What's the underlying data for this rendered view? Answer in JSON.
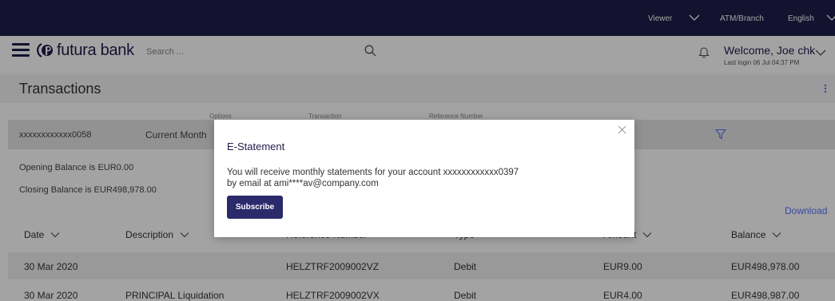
{
  "topbar": {
    "role": "Viewer",
    "atm_branch": "ATM/Branch",
    "language": "English"
  },
  "header": {
    "brand": "futura bank",
    "search_placeholder": "Search ...",
    "welcome": "Welcome, Joe chk",
    "last_login": "Last login 06 Jul 04:37 PM"
  },
  "page": {
    "title": "Transactions"
  },
  "filter": {
    "labels": [
      "Options",
      "Transaction",
      "Reference Number"
    ],
    "account": "xxxxxxxxxxxx0058",
    "period": "Current Month"
  },
  "balances": {
    "opening": "Opening Balance is EUR0.00",
    "closing": "Closing Balance is EUR498,978.00"
  },
  "download_label": "Download",
  "table": {
    "columns": [
      "Date",
      "Description",
      "Reference Number",
      "Type",
      "Amount",
      "Balance"
    ],
    "rows": [
      [
        "30 Mar 2020",
        "",
        "HELZTRF2009002VZ",
        "Debit",
        "EUR9.00",
        "EUR498,978.00"
      ],
      [
        "30 Mar 2020",
        "PRINCIPAL Liquidation",
        "HELZTRF2009002VX",
        "Debit",
        "EUR4.00",
        "EUR498,987.00"
      ]
    ]
  },
  "modal": {
    "title": "E-Statement",
    "line1": "You will receive monthly statements for your account xxxxxxxxxxxx0397",
    "line2": "by email at ami****av@company.com",
    "subscribe_label": "Subscribe"
  },
  "colors": {
    "brand_dark": "#1f1d4a",
    "button": "#2b2a6b",
    "link": "#5271ff"
  }
}
